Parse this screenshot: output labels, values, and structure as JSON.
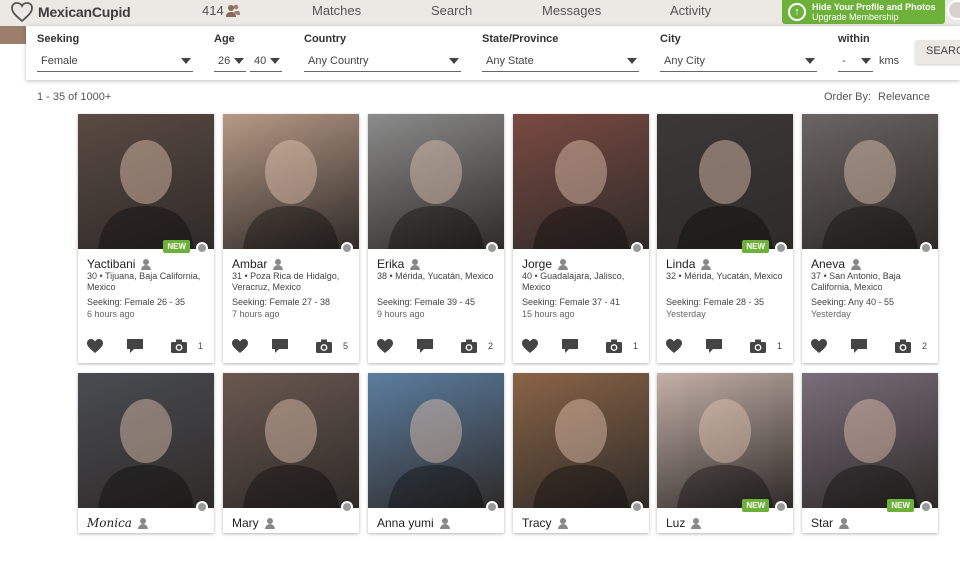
{
  "header": {
    "logo_text": "MexicanCupid",
    "count": "414",
    "nav": [
      "Matches",
      "Search",
      "Messages",
      "Activity"
    ],
    "upgrade_line1": "Hide Your Profile and Photos",
    "upgrade_line2": "Upgrade Membership"
  },
  "filters": {
    "seeking_label": "Seeking",
    "seeking_value": "Female",
    "age_label": "Age",
    "age_min": "26",
    "age_max": "40",
    "country_label": "Country",
    "country_value": "Any Country",
    "state_label": "State/Province",
    "state_value": "Any State",
    "city_label": "City",
    "city_value": "Any City",
    "within_label": "within",
    "within_value": "-",
    "within_unit": "kms",
    "search_button": "SEARCH"
  },
  "results": {
    "count_text": "1 - 35 of 1000+",
    "order_label": "Order By:",
    "order_value": "Relevance"
  },
  "new_badge": "NEW",
  "profiles_row1": [
    {
      "name": "Yactibani",
      "loc": "30 • Tijuana, Baja California, Mexico",
      "seeking": "Seeking: Female 26 - 35",
      "time": "6 hours ago",
      "photos": "1",
      "is_new": true,
      "photo_color": "#5a4a42"
    },
    {
      "name": "Ambar",
      "loc": "31 • Poza Rica de Hidalgo, Veracruz, Mexico",
      "seeking": "Seeking: Female 27 - 38",
      "time": "7 hours ago",
      "photos": "5",
      "is_new": false,
      "photo_color": "#b79a86"
    },
    {
      "name": "Erika",
      "loc": "38 • Mérida, Yucatán, Mexico",
      "seeking": "Seeking: Female 39 - 45",
      "time": "9 hours ago",
      "photos": "2",
      "is_new": false,
      "photo_color": "#8c8c8c"
    },
    {
      "name": "Jorge",
      "loc": "40 • Guadalajara, Jalisco, Mexico",
      "seeking": "Seeking: Female 37 - 41",
      "time": "15 hours ago",
      "photos": "1",
      "is_new": false,
      "photo_color": "#7a4a42"
    },
    {
      "name": "Linda",
      "loc": "32 • Mérida, Yucatán, Mexico",
      "seeking": "Seeking: Female 28 - 35",
      "time": "Yesterday",
      "photos": "1",
      "is_new": true,
      "photo_color": "#3c3838"
    },
    {
      "name": "Aneva",
      "loc": "37 • San Antonio, Baja California, Mexico",
      "seeking": "Seeking: Any 40 - 55",
      "time": "Yesterday",
      "photos": "2",
      "is_new": false,
      "photo_color": "#6a6462"
    }
  ],
  "profiles_row2": [
    {
      "name": "Monica",
      "is_new": false,
      "photo_color": "#4a4c52"
    },
    {
      "name": "Mary",
      "is_new": false,
      "photo_color": "#6a5850"
    },
    {
      "name": "Anna yumi",
      "is_new": false,
      "photo_color": "#5b7ea0"
    },
    {
      "name": "Tracy",
      "is_new": false,
      "photo_color": "#8a6446"
    },
    {
      "name": "Luz",
      "is_new": true,
      "photo_color": "#c4b0a8"
    },
    {
      "name": "Star",
      "is_new": true,
      "photo_color": "#7a6e7a"
    }
  ],
  "colors": {
    "accent_green": "#6eb13a",
    "nav_bg": "#ece8e4",
    "brand_brown": "#9c7e6c"
  }
}
